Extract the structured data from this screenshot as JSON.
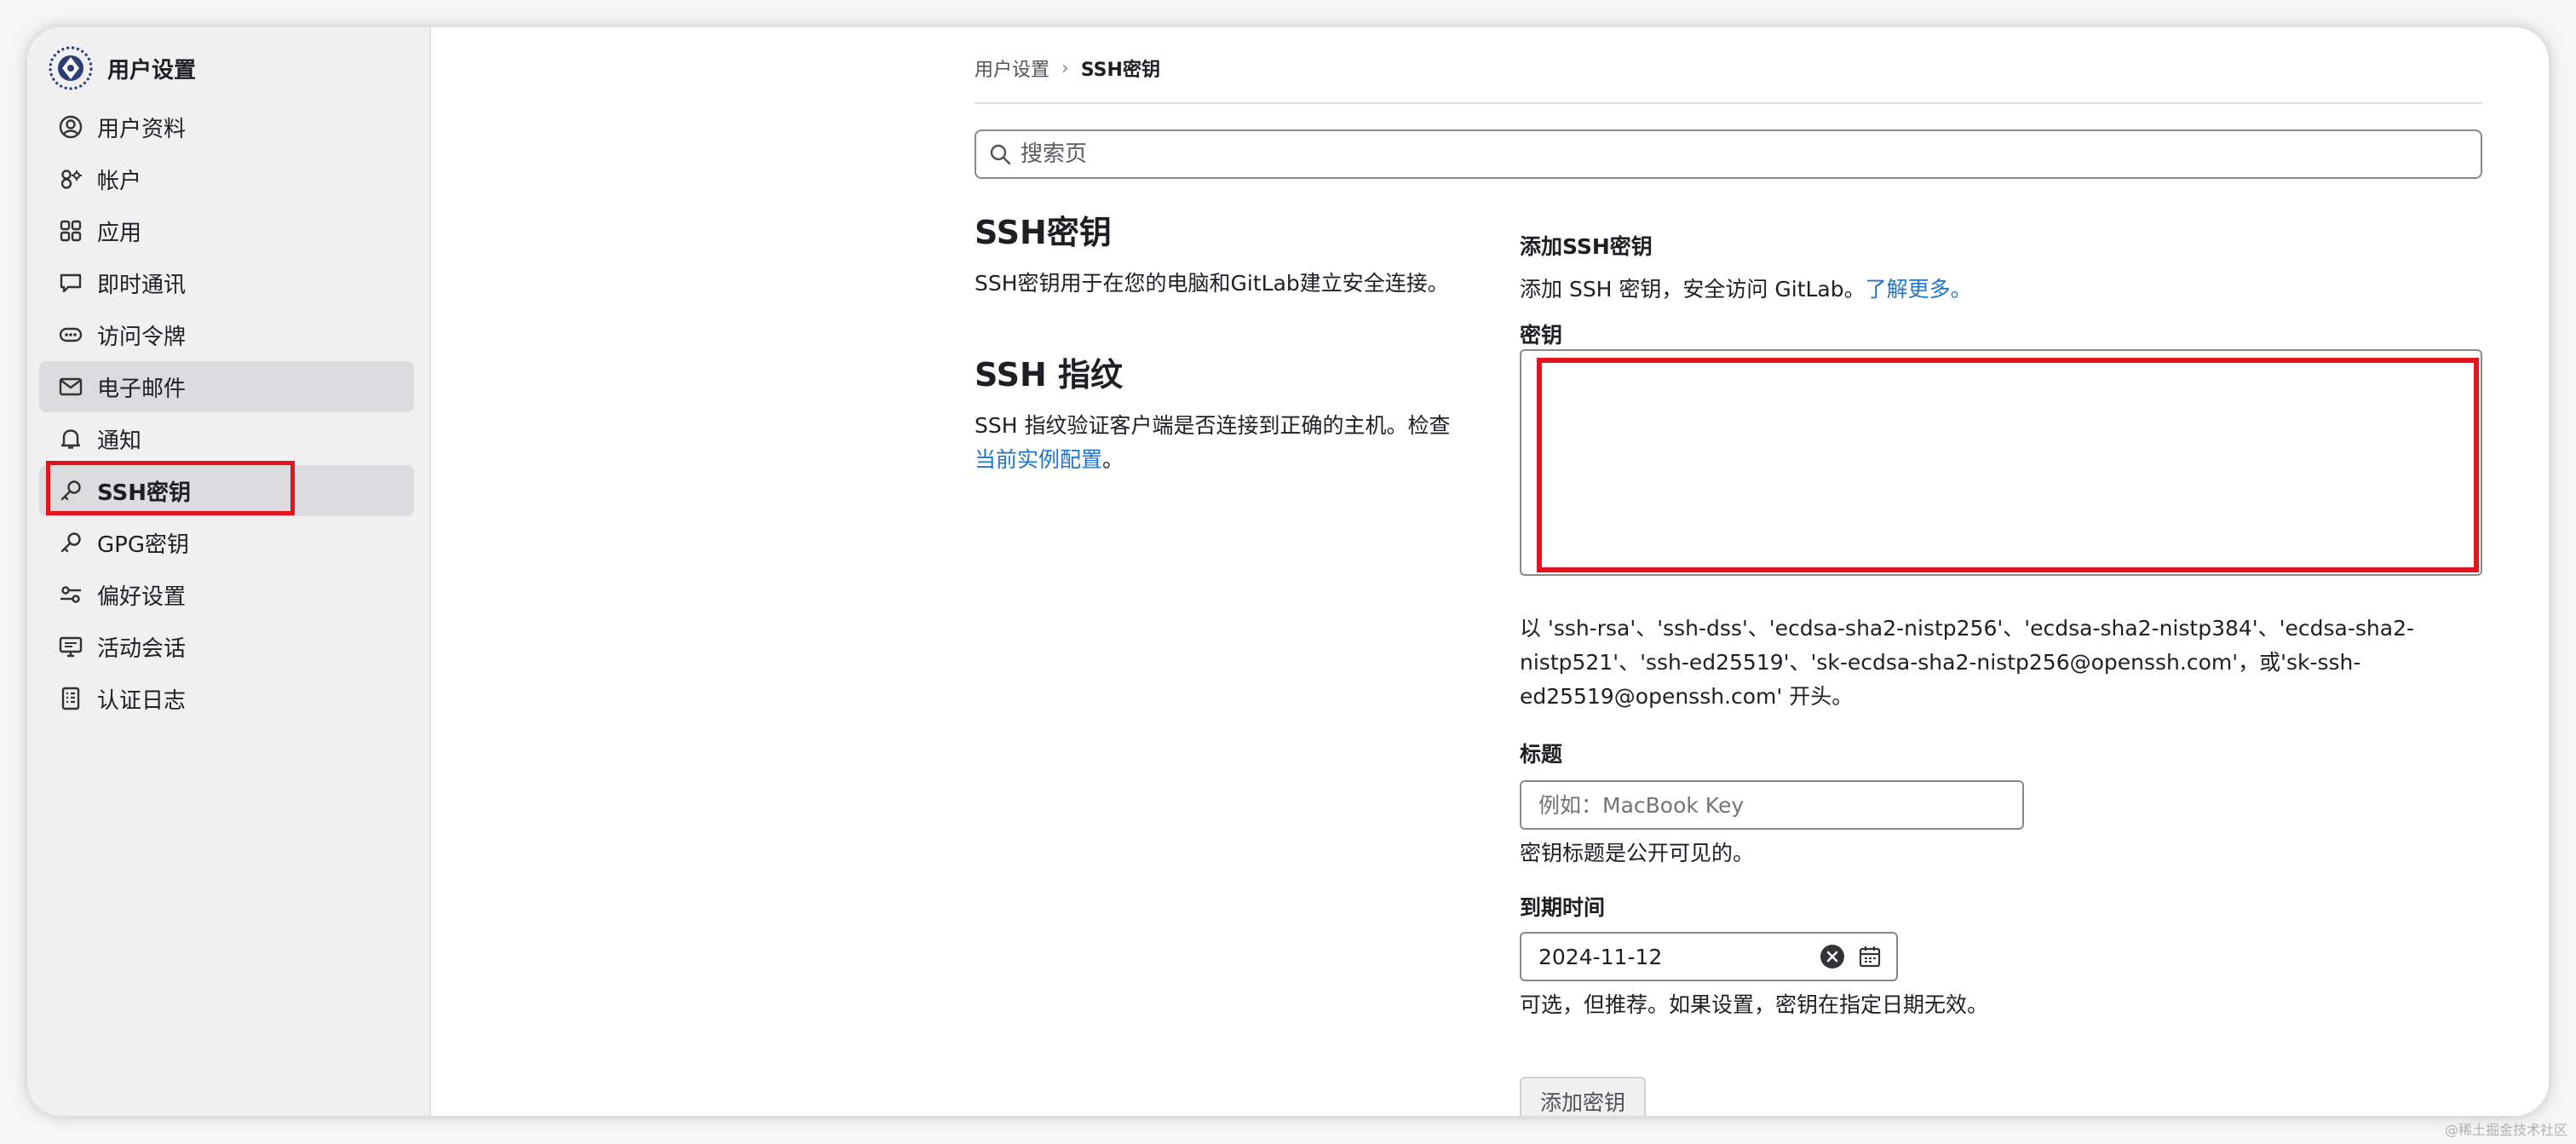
{
  "app": {
    "title": "用户设置"
  },
  "sidebar": {
    "items": [
      {
        "label": "用户资料",
        "icon": "profile-icon"
      },
      {
        "label": "帐户",
        "icon": "account-icon"
      },
      {
        "label": "应用",
        "icon": "applications-icon"
      },
      {
        "label": "即时通讯",
        "icon": "chat-icon"
      },
      {
        "label": "访问令牌",
        "icon": "token-icon"
      },
      {
        "label": "电子邮件",
        "icon": "mail-icon"
      },
      {
        "label": "通知",
        "icon": "bell-icon"
      },
      {
        "label": "SSH密钥",
        "icon": "key-icon"
      },
      {
        "label": "GPG密钥",
        "icon": "key-icon"
      },
      {
        "label": "偏好设置",
        "icon": "preferences-icon"
      },
      {
        "label": "活动会话",
        "icon": "monitor-icon"
      },
      {
        "label": "认证日志",
        "icon": "log-icon"
      }
    ]
  },
  "breadcrumb": {
    "root": "用户设置",
    "current": "SSH密钥"
  },
  "search": {
    "placeholder": "搜索页"
  },
  "ssh_keys_section": {
    "title": "SSH密钥",
    "description": "SSH密钥用于在您的电脑和GitLab建立安全连接。"
  },
  "fingerprint_section": {
    "title": "SSH 指纹",
    "description_prefix": "SSH 指纹验证客户端是否连接到正确的主机。检查",
    "link": "当前实例配置",
    "description_suffix": "。"
  },
  "add_form": {
    "title": "添加SSH密钥",
    "intro_prefix": "添加 SSH 密钥，安全访问 GitLab。",
    "intro_link": "了解更多",
    "intro_suffix": "。",
    "key_label": "密钥",
    "key_value": "",
    "key_help": "以 'ssh-rsa'、'ssh-dss'、'ecdsa-sha2-nistp256'、'ecdsa-sha2-nistp384'、'ecdsa-sha2-nistp521'、'ssh-ed25519'、'sk-ecdsa-sha2-nistp256@openssh.com'，或'sk-ssh-ed25519@openssh.com' 开头。",
    "title_label": "标题",
    "title_placeholder": "例如：MacBook Key",
    "title_help": "密钥标题是公开可见的。",
    "expiry_label": "到期时间",
    "expiry_value": "2024-11-12",
    "expiry_help": "可选，但推荐。如果设置，密钥在指定日期无效。",
    "submit_label": "添加密钥"
  },
  "watermark": "@稀土掘金技术社区",
  "colors": {
    "accent_link": "#1f75cb",
    "highlight": "#e3141b",
    "sidebar_bg": "#f0f0f1"
  }
}
